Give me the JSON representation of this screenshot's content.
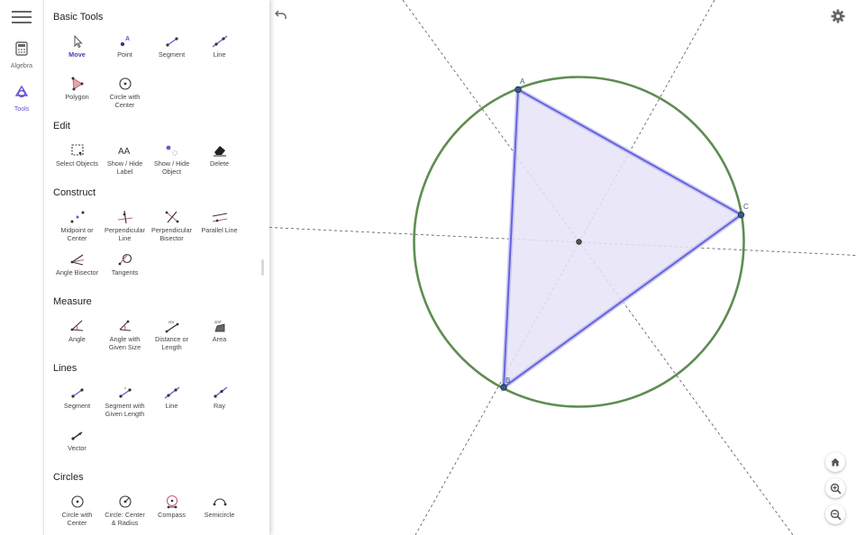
{
  "rail": {
    "algebra_label": "Algebra",
    "tools_label": "Tools"
  },
  "sections": {
    "basic": "Basic Tools",
    "edit": "Edit",
    "construct": "Construct",
    "measure": "Measure",
    "lines": "Lines",
    "circles": "Circles"
  },
  "tools": {
    "move": "Move",
    "point": "Point",
    "segment": "Segment",
    "line": "Line",
    "polygon": "Polygon",
    "circle_center": "Circle with\nCenter",
    "select_objects": "Select Objects",
    "show_hide_label": "Show / Hide\nLabel",
    "show_hide_object": "Show / Hide\nObject",
    "delete": "Delete",
    "midpoint": "Midpoint or\nCenter",
    "perpendicular_line": "Perpendicular\nLine",
    "perpendicular_bisector": "Perpendicular\nBisector",
    "parallel_line": "Parallel Line",
    "angle_bisector": "Angle Bisector",
    "tangents": "Tangents",
    "angle": "Angle",
    "angle_given_size": "Angle with\nGiven Size",
    "distance": "Distance or\nLength",
    "area": "Area",
    "lines_segment": "Segment",
    "segment_given_length": "Segment with\nGiven Length",
    "lines_line": "Line",
    "ray": "Ray",
    "vector": "Vector",
    "circles_circle_center": "Circle with\nCenter",
    "circle_center_radius": "Circle: Center\n& Radius",
    "compass": "Compass",
    "semicircle": "Semicircle"
  },
  "icon_text": {
    "point_label": "A",
    "show_hide_label_glyph": "AA",
    "area_unit": "cm²",
    "distance_unit": "cm"
  },
  "points": {
    "a": "A",
    "b": "B",
    "c": "C"
  },
  "colors": {
    "accent": "#6557d2",
    "circle": "#5e8d51",
    "triangle_stroke": "#6060dd",
    "triangle_fill": "#e6e4f7",
    "point": "#3a5a8c"
  }
}
